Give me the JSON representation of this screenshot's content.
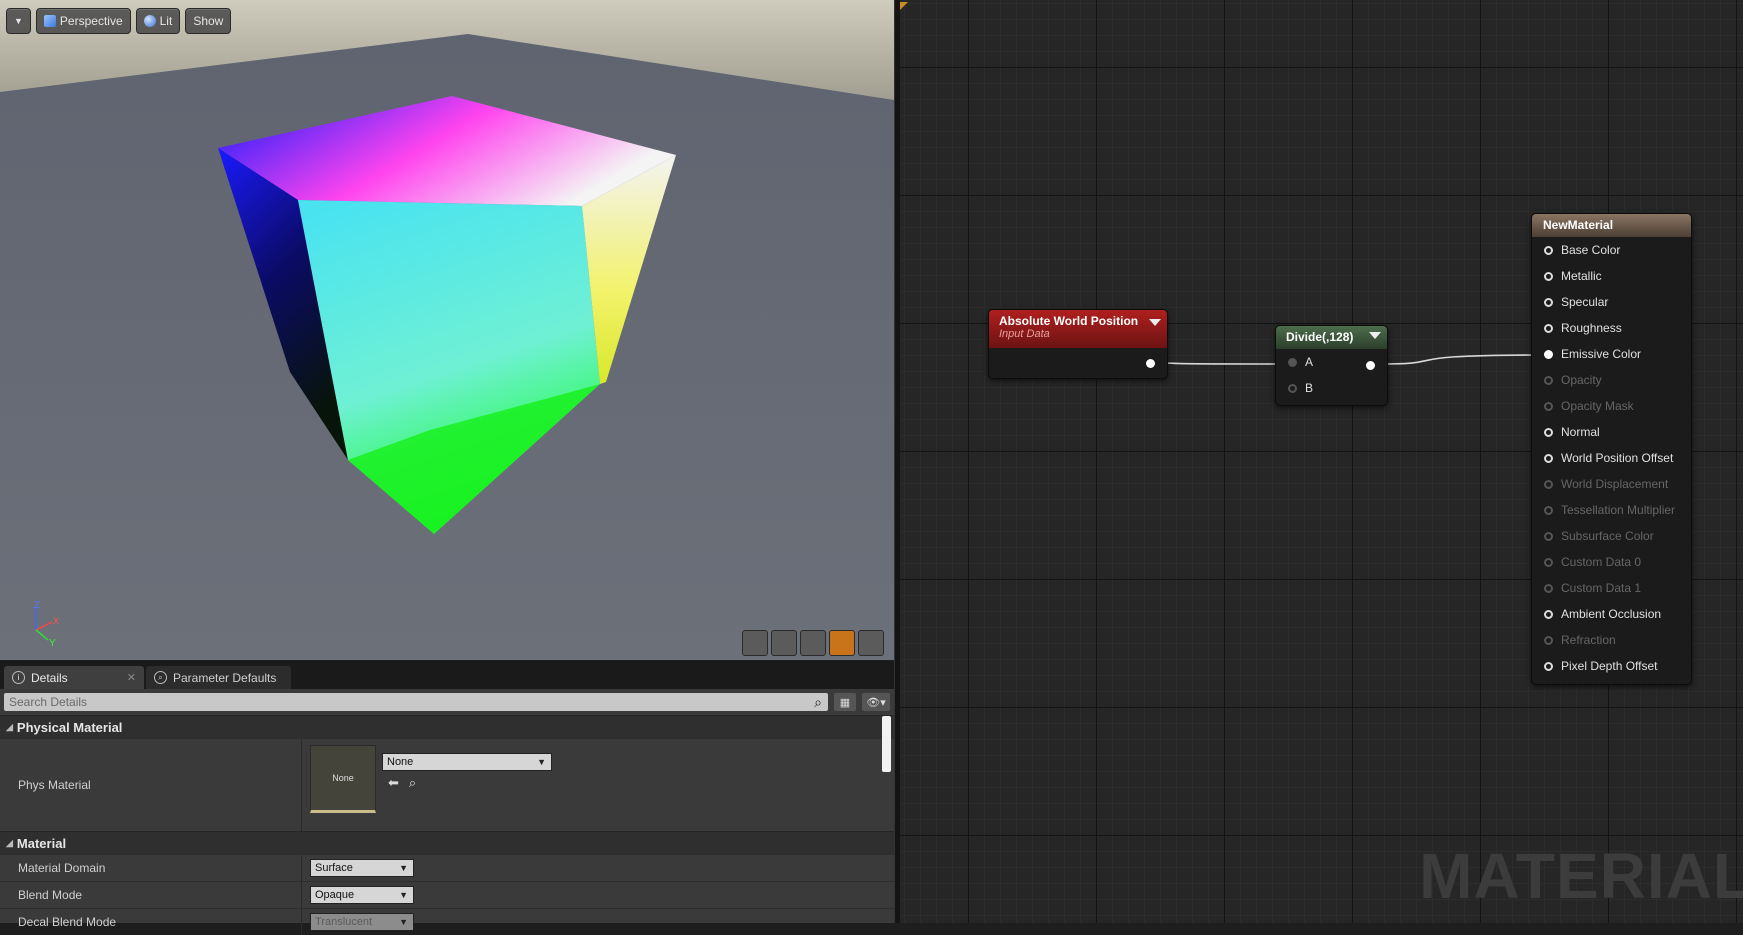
{
  "viewport": {
    "toolbar": {
      "perspective_label": "Perspective",
      "lit_label": "Lit",
      "show_label": "Show"
    },
    "axis_labels": {
      "x": "X",
      "y": "Y",
      "z": "Z"
    }
  },
  "details": {
    "tabs": [
      {
        "label": "Details"
      },
      {
        "label": "Parameter Defaults"
      }
    ],
    "search_placeholder": "Search Details",
    "categories": {
      "physical_material": {
        "title": "Physical Material",
        "phys_material": {
          "label": "Phys Material",
          "thumb_text": "None",
          "value": "None"
        }
      },
      "material": {
        "title": "Material",
        "props": [
          {
            "label": "Material Domain",
            "value": "Surface"
          },
          {
            "label": "Blend Mode",
            "value": "Opaque"
          },
          {
            "label": "Decal Blend Mode",
            "value": "Translucent"
          }
        ]
      }
    }
  },
  "graph": {
    "awp_node": {
      "title": "Absolute World Position",
      "subtitle": "Input Data",
      "color": "#8e1b1b"
    },
    "divide_node": {
      "title": "Divide(,128)",
      "inputs": [
        "A",
        "B"
      ],
      "color": "#3a5a3a"
    },
    "material_node": {
      "title": "NewMaterial",
      "color": "#5a4a3e",
      "pins": [
        {
          "label": "Base Color",
          "enabled": true
        },
        {
          "label": "Metallic",
          "enabled": true
        },
        {
          "label": "Specular",
          "enabled": true
        },
        {
          "label": "Roughness",
          "enabled": true
        },
        {
          "label": "Emissive Color",
          "enabled": true,
          "connected": true
        },
        {
          "label": "Opacity",
          "enabled": false
        },
        {
          "label": "Opacity Mask",
          "enabled": false
        },
        {
          "label": "Normal",
          "enabled": true
        },
        {
          "label": "World Position Offset",
          "enabled": true
        },
        {
          "label": "World Displacement",
          "enabled": false
        },
        {
          "label": "Tessellation Multiplier",
          "enabled": false
        },
        {
          "label": "Subsurface Color",
          "enabled": false
        },
        {
          "label": "Custom Data 0",
          "enabled": false
        },
        {
          "label": "Custom Data 1",
          "enabled": false
        },
        {
          "label": "Ambient Occlusion",
          "enabled": true
        },
        {
          "label": "Refraction",
          "enabled": false
        },
        {
          "label": "Pixel Depth Offset",
          "enabled": true
        }
      ]
    },
    "watermark": "MATERIAL"
  }
}
